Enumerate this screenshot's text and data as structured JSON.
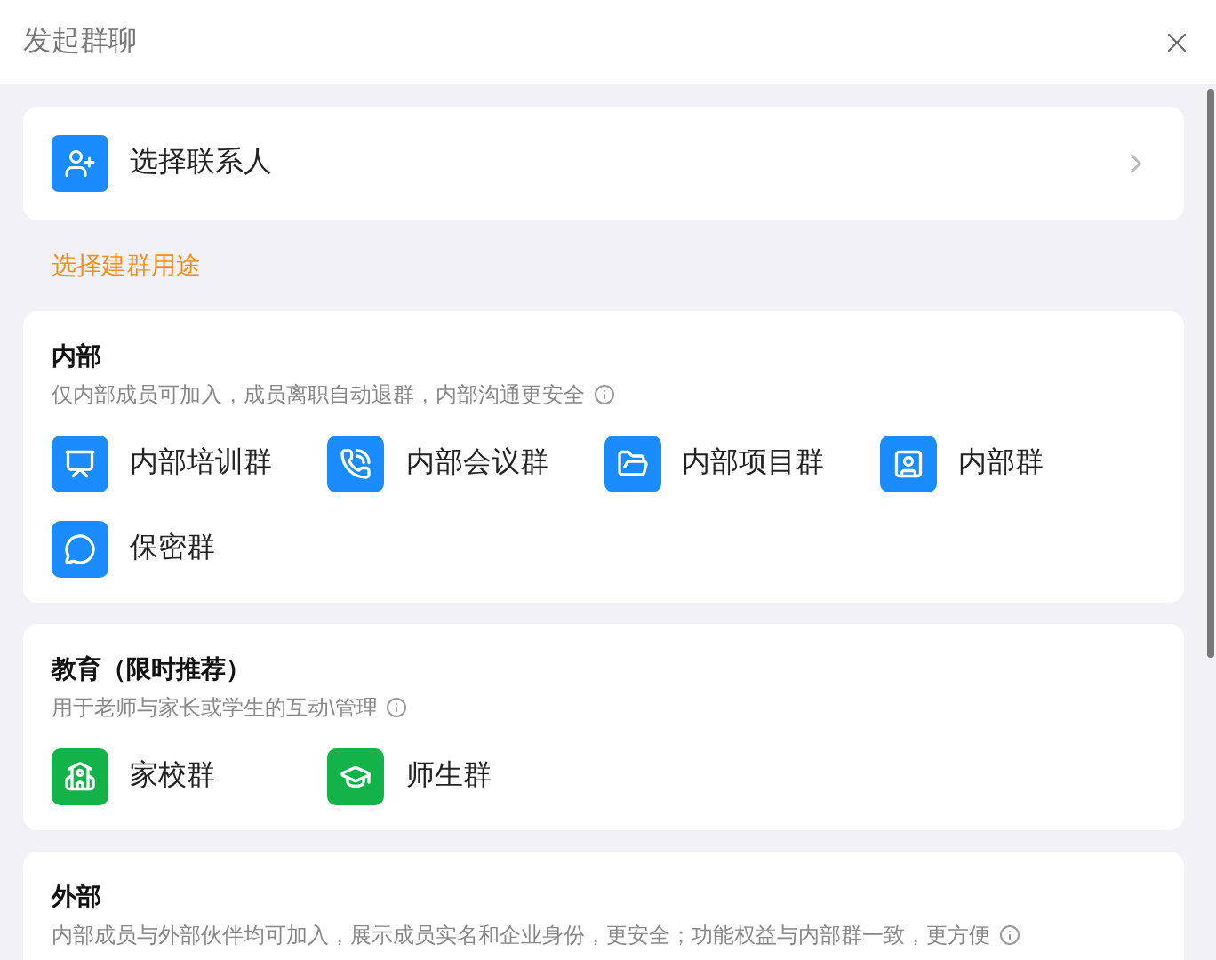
{
  "window": {
    "title": "发起群聊"
  },
  "contact_picker": {
    "label": "选择联系人"
  },
  "purpose_heading": "选择建群用途",
  "sections": [
    {
      "title": "内部",
      "description": "仅内部成员可加入，成员离职自动退群，内部沟通更安全",
      "color": "#1a8cff",
      "items": [
        {
          "label": "内部培训群"
        },
        {
          "label": "内部会议群"
        },
        {
          "label": "内部项目群"
        },
        {
          "label": "内部群"
        },
        {
          "label": "保密群"
        }
      ]
    },
    {
      "title": "教育（限时推荐）",
      "description": "用于老师与家长或学生的互动\\管理",
      "color": "#13b34a",
      "items": [
        {
          "label": "家校群"
        },
        {
          "label": "师生群"
        }
      ]
    },
    {
      "title": "外部",
      "description": "内部成员与外部伙伴均可加入，展示成员实名和企业身份，更安全；功能权益与内部群一致，更方便"
    }
  ]
}
